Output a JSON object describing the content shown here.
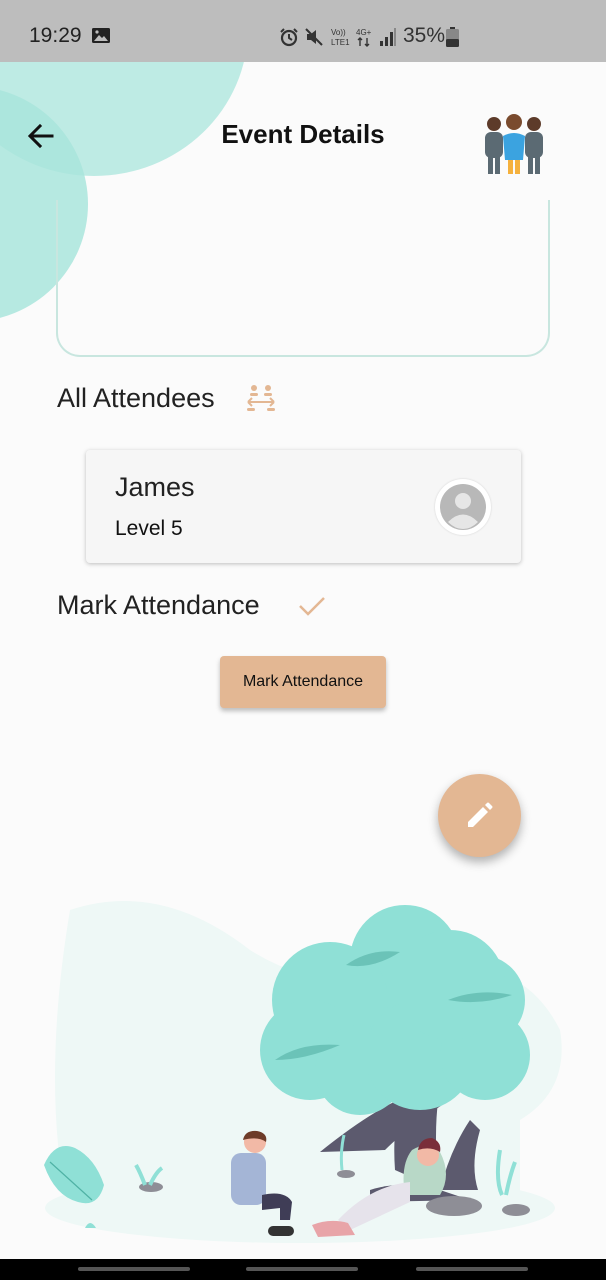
{
  "status_bar": {
    "time": "19:29",
    "battery": "35%",
    "icons": [
      "image-icon",
      "alarm-icon",
      "mute-icon",
      "volte-icon",
      "4g-icon",
      "signal-icon",
      "battery-icon"
    ]
  },
  "header": {
    "title": "Event Details",
    "back_icon": "arrow-left-icon",
    "group_icon": "people-group-icon"
  },
  "attendees": {
    "section_title": "All Attendees",
    "icon": "attendees-icon",
    "items": [
      {
        "name": "James",
        "level": "Level 5",
        "avatar": "default-avatar-icon"
      }
    ]
  },
  "attendance": {
    "section_title": "Mark Attendance",
    "icon": "check-icon",
    "button_label": "Mark Attendance"
  },
  "fab": {
    "icon": "pencil-icon"
  },
  "colors": {
    "accent": "#e3b793",
    "teal": "#8fe0d6",
    "status_bar": "#bdbdbd",
    "background": "#fbfbfb"
  }
}
